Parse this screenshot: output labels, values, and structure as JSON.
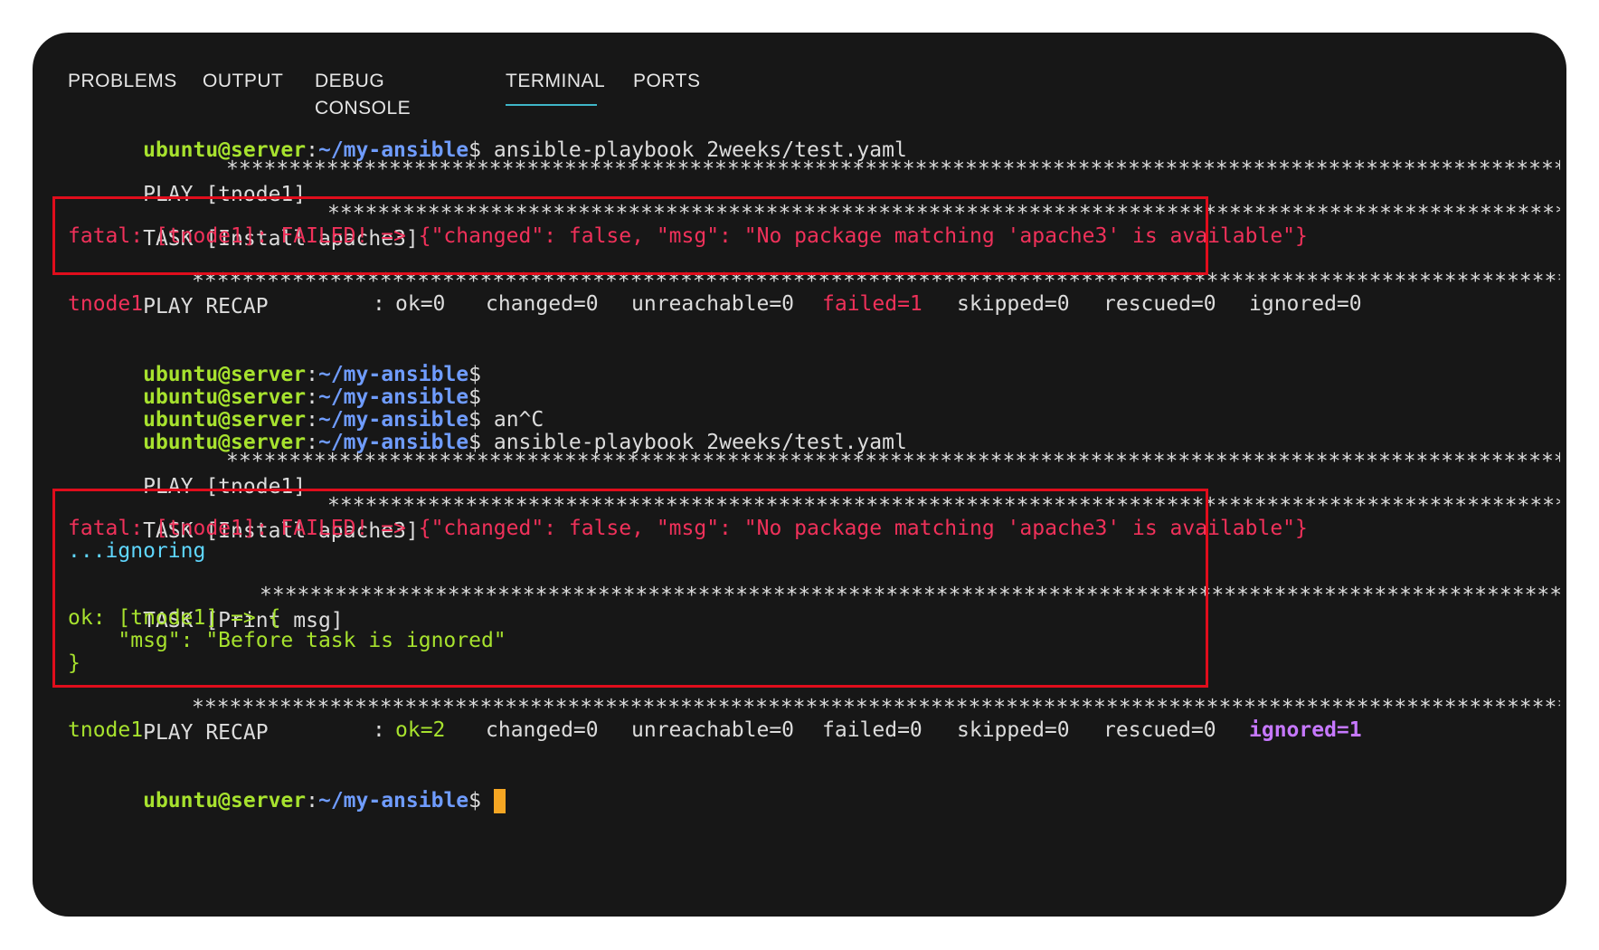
{
  "tabs": [
    "PROBLEMS",
    "OUTPUT",
    "DEBUG CONSOLE",
    "TERMINAL",
    "PORTS"
  ],
  "active_tab": "TERMINAL",
  "prompt": {
    "user_host": "ubuntu@server",
    "colon": ":",
    "path": "~/my-ansible",
    "symbol": "$"
  },
  "run1": {
    "command": " ansible-playbook 2weeks/test.yaml",
    "play": "PLAY [tnode1] ",
    "task": "TASK [Install apache3] ",
    "fatal": "fatal: [tnode1]: FAILED! => {\"changed\": false, \"msg\": \"No package matching 'apache3' is available\"}",
    "recap": "PLAY RECAP ",
    "host": "tnode1",
    "sep": ":",
    "ok": "ok=0",
    "changed": "changed=0",
    "unreachable": "unreachable=0",
    "failed": "failed=1",
    "skipped": "skipped=0",
    "rescued": "rescued=0",
    "ignored": "ignored=0"
  },
  "between": {
    "cmd3": " an^C",
    "cmd4": " ansible-playbook 2weeks/test.yaml"
  },
  "run2": {
    "play": "PLAY [tnode1] ",
    "task": "TASK [Install apache3] ",
    "fatal": "fatal: [tnode1]: FAILED! => {\"changed\": false, \"msg\": \"No package matching 'apache3' is available\"}",
    "ignoring": "...ignoring",
    "task2": "TASK [Print msg] ",
    "ok_line": "ok: [tnode1] => {",
    "msg_line": "    \"msg\": \"Before task is ignored\"",
    "close": "}",
    "recap": "PLAY RECAP ",
    "host": "tnode1",
    "sep": ":",
    "ok": "ok=2",
    "changed": "changed=0",
    "unreachable": "unreachable=0",
    "failed": "failed=0",
    "skipped": "skipped=0",
    "rescued": "rescued=0",
    "ignored": "ignored=1"
  },
  "colors": {
    "background": "#171717",
    "prompt_user": "#a7e22e",
    "prompt_path": "#6f9cff",
    "error": "#f0315a",
    "ok": "#a7e22e",
    "ignoring": "#5fd7ff",
    "ignored_count": "#c678ff",
    "highlight_box": "#e00d1c",
    "cursor": "#f5a623"
  }
}
